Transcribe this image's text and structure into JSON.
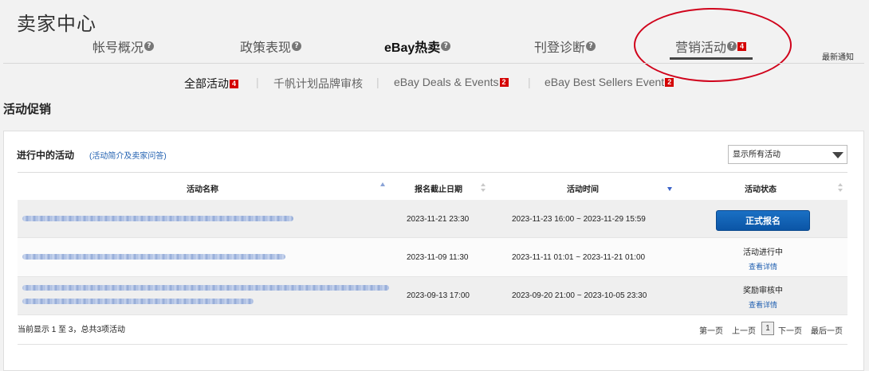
{
  "header": {
    "title": "卖家中心",
    "latest_notice": "最新通知",
    "tabs": [
      {
        "label": "帐号概况",
        "help": "?"
      },
      {
        "label": "政策表现",
        "help": "?"
      },
      {
        "label": "eBay热卖",
        "help": "?"
      },
      {
        "label": "刊登诊断",
        "help": "?"
      },
      {
        "label": "营销活动",
        "help": "?",
        "badge": "4"
      }
    ]
  },
  "subtabs": [
    {
      "label": "全部活动",
      "badge": "4"
    },
    {
      "label": "千帆计划品牌审核"
    },
    {
      "label": "eBay Deals & Events",
      "badge": "2"
    },
    {
      "label": "eBay Best Sellers Event",
      "badge": "2"
    }
  ],
  "separator": "|",
  "section": {
    "title": "活动促销"
  },
  "panel": {
    "ongoing_title": "进行中的活动",
    "ongoing_link": "(活动简介及卖家问答)",
    "filter_value": "显示所有活动"
  },
  "table": {
    "headers": [
      "活动名称",
      "报名截止日期",
      "活动时间",
      "活动状态"
    ],
    "rows": [
      {
        "deadline": "2023-11-21 23:30",
        "period": "2023-11-23 16:00 ~ 2023-11-29 15:59",
        "action": "正式报名"
      },
      {
        "deadline": "2023-11-09 11:30",
        "period": "2023-11-11 01:01 ~ 2023-11-21 01:00",
        "status": "活动进行中",
        "detail": "查看详情"
      },
      {
        "deadline": "2023-09-13 17:00",
        "period": "2023-09-20 21:00 ~ 2023-10-05 23:30",
        "status": "奖励审核中",
        "detail": "查看详情"
      }
    ]
  },
  "footer": {
    "count_text": "当前显示 1 至 3，总共3项活动",
    "pager": {
      "first": "第一页",
      "prev": "上一页",
      "current": "1",
      "next": "下一页",
      "last": "最后一页"
    }
  },
  "colors": {
    "accent": "#0b55a6",
    "badge": "#d40000",
    "annotation": "#d0021b"
  }
}
